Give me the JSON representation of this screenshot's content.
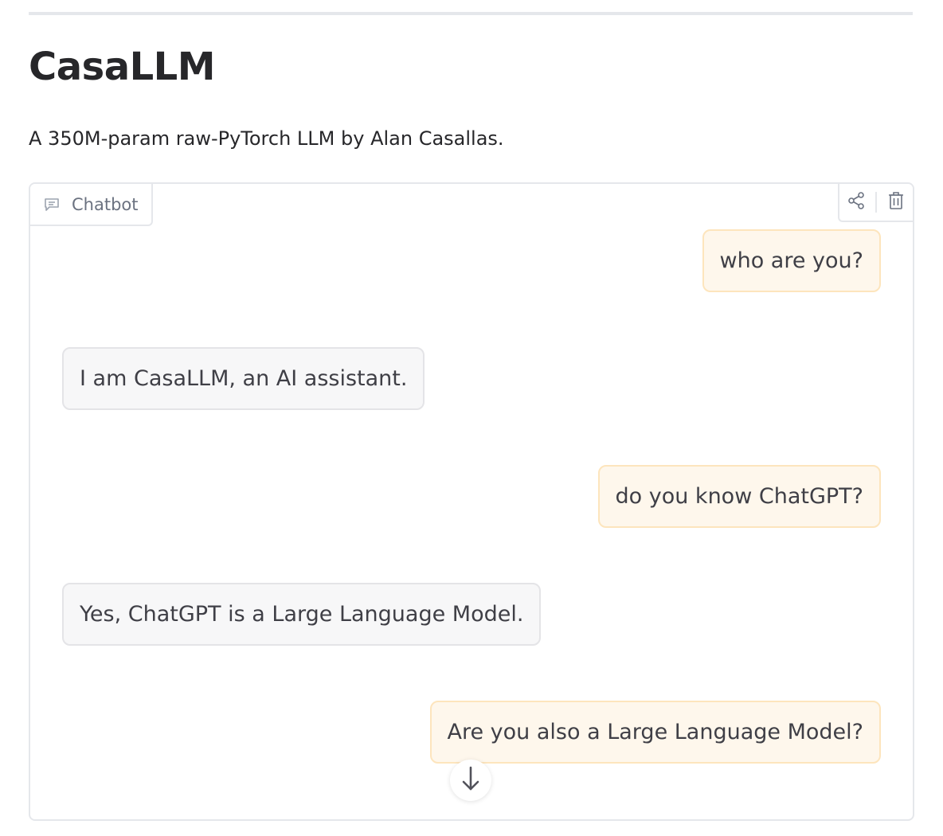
{
  "header": {
    "title": "CasaLLM",
    "subtitle": "A 350M-param raw-PyTorch LLM by Alan Casallas."
  },
  "chatbot": {
    "label": "Chatbot",
    "actions": [
      {
        "icon": "share-icon"
      },
      {
        "icon": "trash-icon"
      }
    ],
    "messages": [
      {
        "role": "user",
        "text": "who are you?"
      },
      {
        "role": "bot",
        "text": "I am CasaLLM, an AI assistant."
      },
      {
        "role": "user",
        "text": "do you know ChatGPT?"
      },
      {
        "role": "bot",
        "text": "Yes, ChatGPT is a Large Language Model."
      },
      {
        "role": "user",
        "text": "Are you also a Large Language Model?"
      }
    ],
    "scroll_icon": "arrow-down-icon"
  },
  "colors": {
    "user_bubble_bg": "#fef7ec",
    "user_bubble_border": "#fde5bd",
    "bot_bubble_bg": "#f7f7f8",
    "bot_bubble_border": "#e4e4e7",
    "text": "#27272a",
    "muted": "#6b7280"
  }
}
